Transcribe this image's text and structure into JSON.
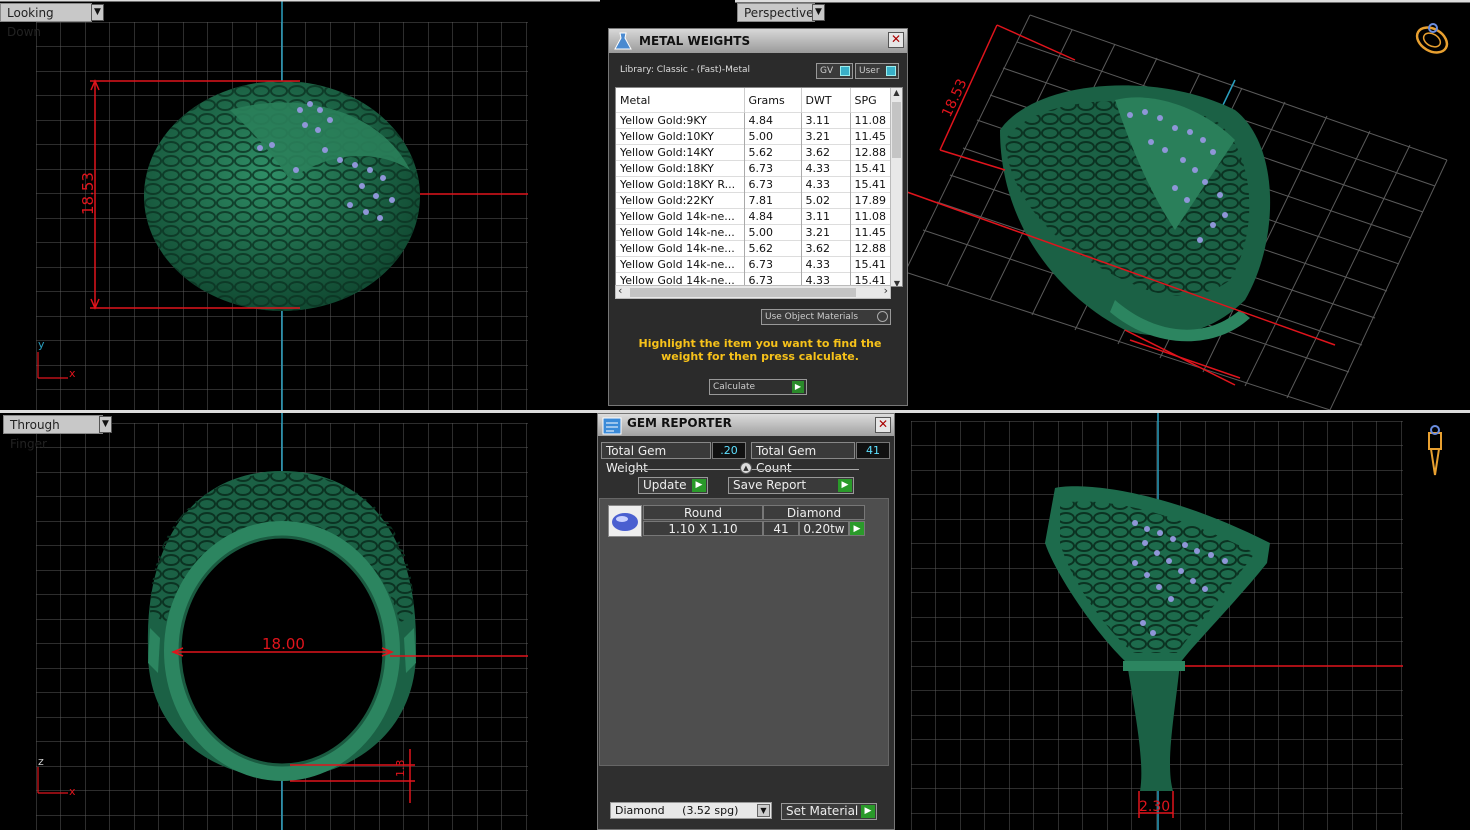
{
  "viewports": {
    "top_left": {
      "label": "Looking Down",
      "dimension": "18.53",
      "axis_v": "y",
      "axis_h": "x"
    },
    "top_right": {
      "label": "Perspective",
      "dimension": "18.53"
    },
    "bottom_left": {
      "label": "Through Finger",
      "dimension": "18.00",
      "dimension_small": "1.3",
      "axis_v": "z",
      "axis_h": "x"
    },
    "bottom_right": {
      "dimension": "2.30"
    }
  },
  "metal_weights": {
    "title": "METAL WEIGHTS",
    "library": "Library: Classic - (Fast)-Metal",
    "gv_label": "GV",
    "user_label": "User",
    "columns": [
      "Metal",
      "Grams",
      "DWT",
      "SPG"
    ],
    "rows": [
      [
        "Yellow Gold:9KY",
        "4.84",
        "3.11",
        "11.08"
      ],
      [
        "Yellow Gold:10KY",
        "5.00",
        "3.21",
        "11.45"
      ],
      [
        "Yellow Gold:14KY",
        "5.62",
        "3.62",
        "12.88"
      ],
      [
        "Yellow Gold:18KY",
        "6.73",
        "4.33",
        "15.41"
      ],
      [
        "Yellow Gold:18KY R...",
        "6.73",
        "4.33",
        "15.41"
      ],
      [
        "Yellow Gold:22KY",
        "7.81",
        "5.02",
        "17.89"
      ],
      [
        "Yellow Gold 14k-ne...",
        "4.84",
        "3.11",
        "11.08"
      ],
      [
        "Yellow Gold 14k-ne...",
        "5.00",
        "3.21",
        "11.45"
      ],
      [
        "Yellow Gold 14k-ne...",
        "5.62",
        "3.62",
        "12.88"
      ],
      [
        "Yellow Gold 14k-ne...",
        "6.73",
        "4.33",
        "15.41"
      ],
      [
        "Yellow Gold 14k-ne...",
        "6.73",
        "4.33",
        "15.41"
      ]
    ],
    "use_object_materials": "Use Object Materials",
    "hint": "Highlight the item you want to find the weight for then press calculate.",
    "calculate": "Calculate"
  },
  "gem_reporter": {
    "title": "GEM REPORTER",
    "total_weight_label": "Total Gem Weight",
    "total_weight_value": ".20",
    "total_count_label": "Total Gem Count",
    "total_count_value": "41",
    "update": "Update",
    "save_report": "Save Report",
    "gem": {
      "shape": "Round",
      "material": "Diamond",
      "size": "1.10 X 1.10",
      "count": "41",
      "weight": "0.20tw"
    },
    "material_select": "Diamond     (3.52 spg)",
    "set_material": "Set Material"
  },
  "colors": {
    "ring": "#1d6b4c",
    "ring_light": "#2f8e66",
    "gems": "#8f96d8",
    "dimension": "#e0141c",
    "grid": "#5a5a5a",
    "accent": "#f7c21a"
  }
}
